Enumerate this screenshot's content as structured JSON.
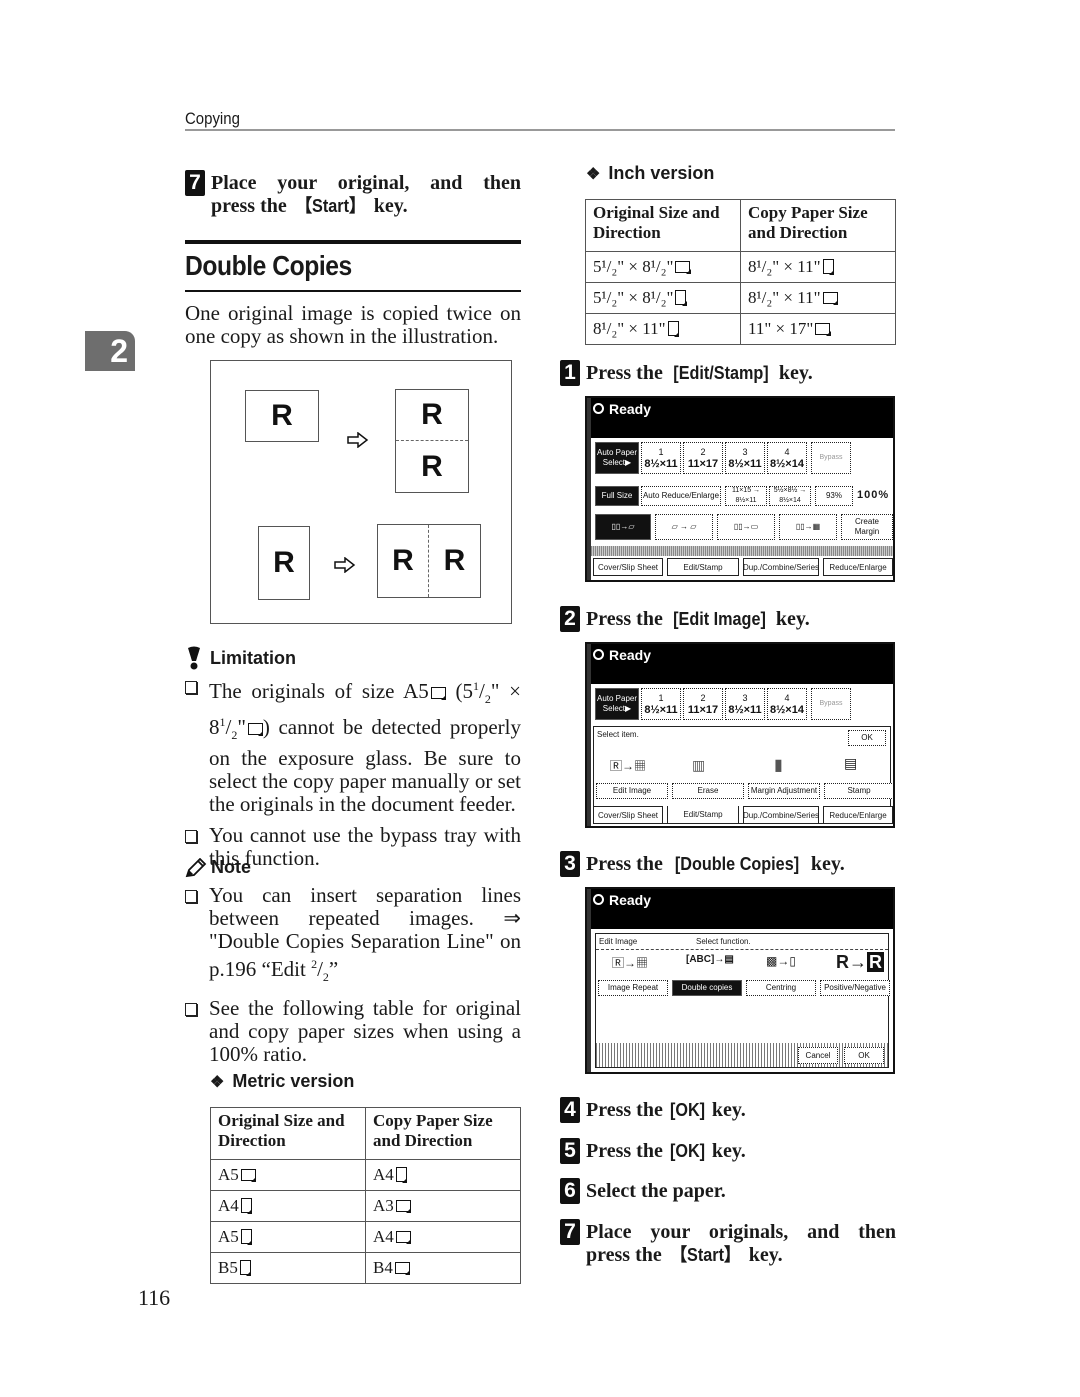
{
  "header": {
    "section": "Copying"
  },
  "chapter_tab": "2",
  "page_number": "116",
  "left_top_step": {
    "number": "7",
    "line1": "Place your original, and then",
    "line2_pre": "press the ",
    "key": "【Start】",
    "line2_post": " key."
  },
  "section": {
    "title": "Double Copies",
    "intro": "One original image is copied twice on one copy as shown in the illustration."
  },
  "illustration": {
    "letter": "R",
    "arrow_icon": "hollow-right-arrow"
  },
  "limitation": {
    "heading": "Limitation",
    "items": [
      {
        "a": "The originals of size A5",
        "b": " (5",
        "c": "1",
        "d": "/",
        "e": "2",
        "f": "\" × 8",
        "g": "1",
        "h": "/",
        "i": "2",
        "j": "\"",
        "k": ") cannot be detected properly on the exposure glass. Be sure to select the copy paper manually or set the originals in the document feeder."
      },
      {
        "text": "You cannot use the bypass tray with this function."
      }
    ]
  },
  "note": {
    "heading": "Note",
    "items": [
      {
        "text": "You can insert separation lines between repeated images. ⇒ \"Double Copies Separation Line\" on p.196 “Edit ",
        "sup": "2",
        "slash": "/",
        "sub": "2",
        "end": "”"
      },
      {
        "text": "See the following table for original and copy paper sizes when using a 100% ratio."
      }
    ]
  },
  "metric_table": {
    "heading": "Metric version",
    "headers": [
      "Original Size and Direction",
      "Copy Paper Size and Direction"
    ],
    "rows": [
      {
        "orig": "A5",
        "orig_dir": "landscape",
        "copy": "A4",
        "copy_dir": "portrait"
      },
      {
        "orig": "A4",
        "orig_dir": "portrait",
        "copy": "A3",
        "copy_dir": "landscape"
      },
      {
        "orig": "A5",
        "orig_dir": "portrait",
        "copy": "A4",
        "copy_dir": "landscape"
      },
      {
        "orig": "B5",
        "orig_dir": "portrait",
        "copy": "B4",
        "copy_dir": "landscape"
      }
    ]
  },
  "inch_table": {
    "heading": "Inch version",
    "headers": [
      "Original Size and Direction",
      "Copy Paper Size and Direction"
    ],
    "rows": [
      {
        "orig": "5¹/₂\" × 8¹/₂\"",
        "orig_dir": "landscape",
        "copy": "8¹/₂\" × 11\"",
        "copy_dir": "portrait"
      },
      {
        "orig": "5¹/₂\" × 8¹/₂\"",
        "orig_dir": "portrait",
        "copy": "8¹/₂\" × 11\"",
        "copy_dir": "landscape"
      },
      {
        "orig": "8¹/₂\" × 11\"",
        "orig_dir": "portrait",
        "copy": "11\" × 17\"",
        "copy_dir": "landscape"
      }
    ]
  },
  "steps": [
    {
      "number": "1",
      "pre": "Press the ",
      "key": "[Edit/Stamp]",
      "post": " key."
    },
    {
      "number": "2",
      "pre": "Press the ",
      "key": "[Edit Image]",
      "post": " key."
    },
    {
      "number": "3",
      "pre": "Press the ",
      "key": "[Double Copies]",
      "post": " key."
    },
    {
      "number": "4",
      "pre": "Press the ",
      "key": "[OK]",
      "post": " key."
    },
    {
      "number": "5",
      "pre": "Press the ",
      "key": "[OK]",
      "post": " key."
    },
    {
      "number": "6",
      "pre": "Select the paper.",
      "key": "",
      "post": ""
    },
    {
      "number": "7",
      "pre": "Place your originals, and then",
      "line2_pre": "press the ",
      "key": "【Start】",
      "post": " key."
    }
  ],
  "screens": {
    "status": "Ready",
    "auto_paper": "Auto Paper Select▶",
    "trays": [
      {
        "no": "1",
        "size": "8½×11"
      },
      {
        "no": "2",
        "size": "11×17"
      },
      {
        "no": "3",
        "size": "8½×11"
      },
      {
        "no": "4",
        "size": "8½×14"
      }
    ],
    "bypass": "Bypass",
    "full_size": "Full Size",
    "auto_reduce": "Auto Reduce/Enlarge",
    "ratio1": "11×15 → 8½×11",
    "ratio2": "5½×8½ → 8½×14",
    "ratio_value": "93%",
    "ratio_display": "100%",
    "create_margin": "Create Margin",
    "tabs": [
      "Cover/Slip Sheet",
      "Edit/Stamp",
      "Dup./Combine/Series",
      "Reduce/Enlarge"
    ],
    "select_item": "Select item.",
    "ok": "OK",
    "edit_items": [
      "Edit Image",
      "Erase",
      "Margin Adjustment",
      "Stamp"
    ],
    "edit_image_title": "Edit Image",
    "select_function": "Select function.",
    "functions": [
      "Image Repeat",
      "Double copies",
      "Centring",
      "Positive/Negative"
    ],
    "cancel": "Cancel"
  }
}
